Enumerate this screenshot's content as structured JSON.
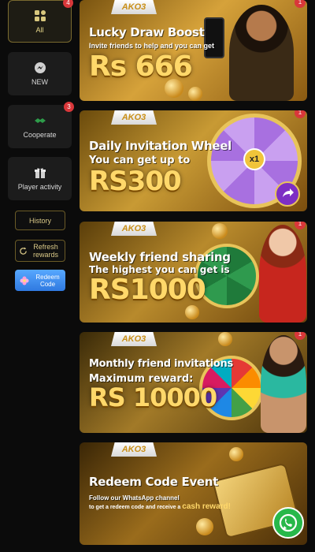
{
  "sidebar": {
    "categories": [
      {
        "label": "All",
        "badge": "4",
        "icon": "grid-icon"
      },
      {
        "label": "NEW",
        "badge": "",
        "icon": "messenger-icon"
      },
      {
        "label": "Cooperate",
        "badge": "3",
        "icon": "handshake-icon"
      },
      {
        "label": "Player activity",
        "badge": "",
        "icon": "gift-icon"
      }
    ],
    "history_label": "History",
    "refresh_label": "Refresh rewards",
    "redeem_label": "Redeem Code"
  },
  "banners": [
    {
      "logo": "AKO3",
      "title": "Lucky Draw Boost",
      "subtitle": "Invite friends to help and you can get",
      "amount": "Rs 666",
      "badge": "1"
    },
    {
      "logo": "AKO3",
      "title": "Daily Invitation Wheel",
      "subtitle": "You can get up to",
      "amount": "RS300",
      "badge": "1",
      "wheel_center": "x1"
    },
    {
      "logo": "AKO3",
      "title": "Weekly friend sharing",
      "subtitle": "The highest you can get is",
      "amount": "RS1000",
      "badge": "1"
    },
    {
      "logo": "AKO3",
      "title": "Monthly friend invitations",
      "subtitle": "Maximum reward:",
      "amount": "RS 10000",
      "badge": "1"
    },
    {
      "logo": "AKO3",
      "title": "Redeem Code Event",
      "subtitle": "Follow our WhatsApp channel",
      "subtitle2": "to get a redeem code and receive a",
      "highlight": "cash reward!"
    }
  ],
  "colors": {
    "gold": "#ffd86a",
    "badge": "#d9373a",
    "accent": "#d9c887"
  }
}
